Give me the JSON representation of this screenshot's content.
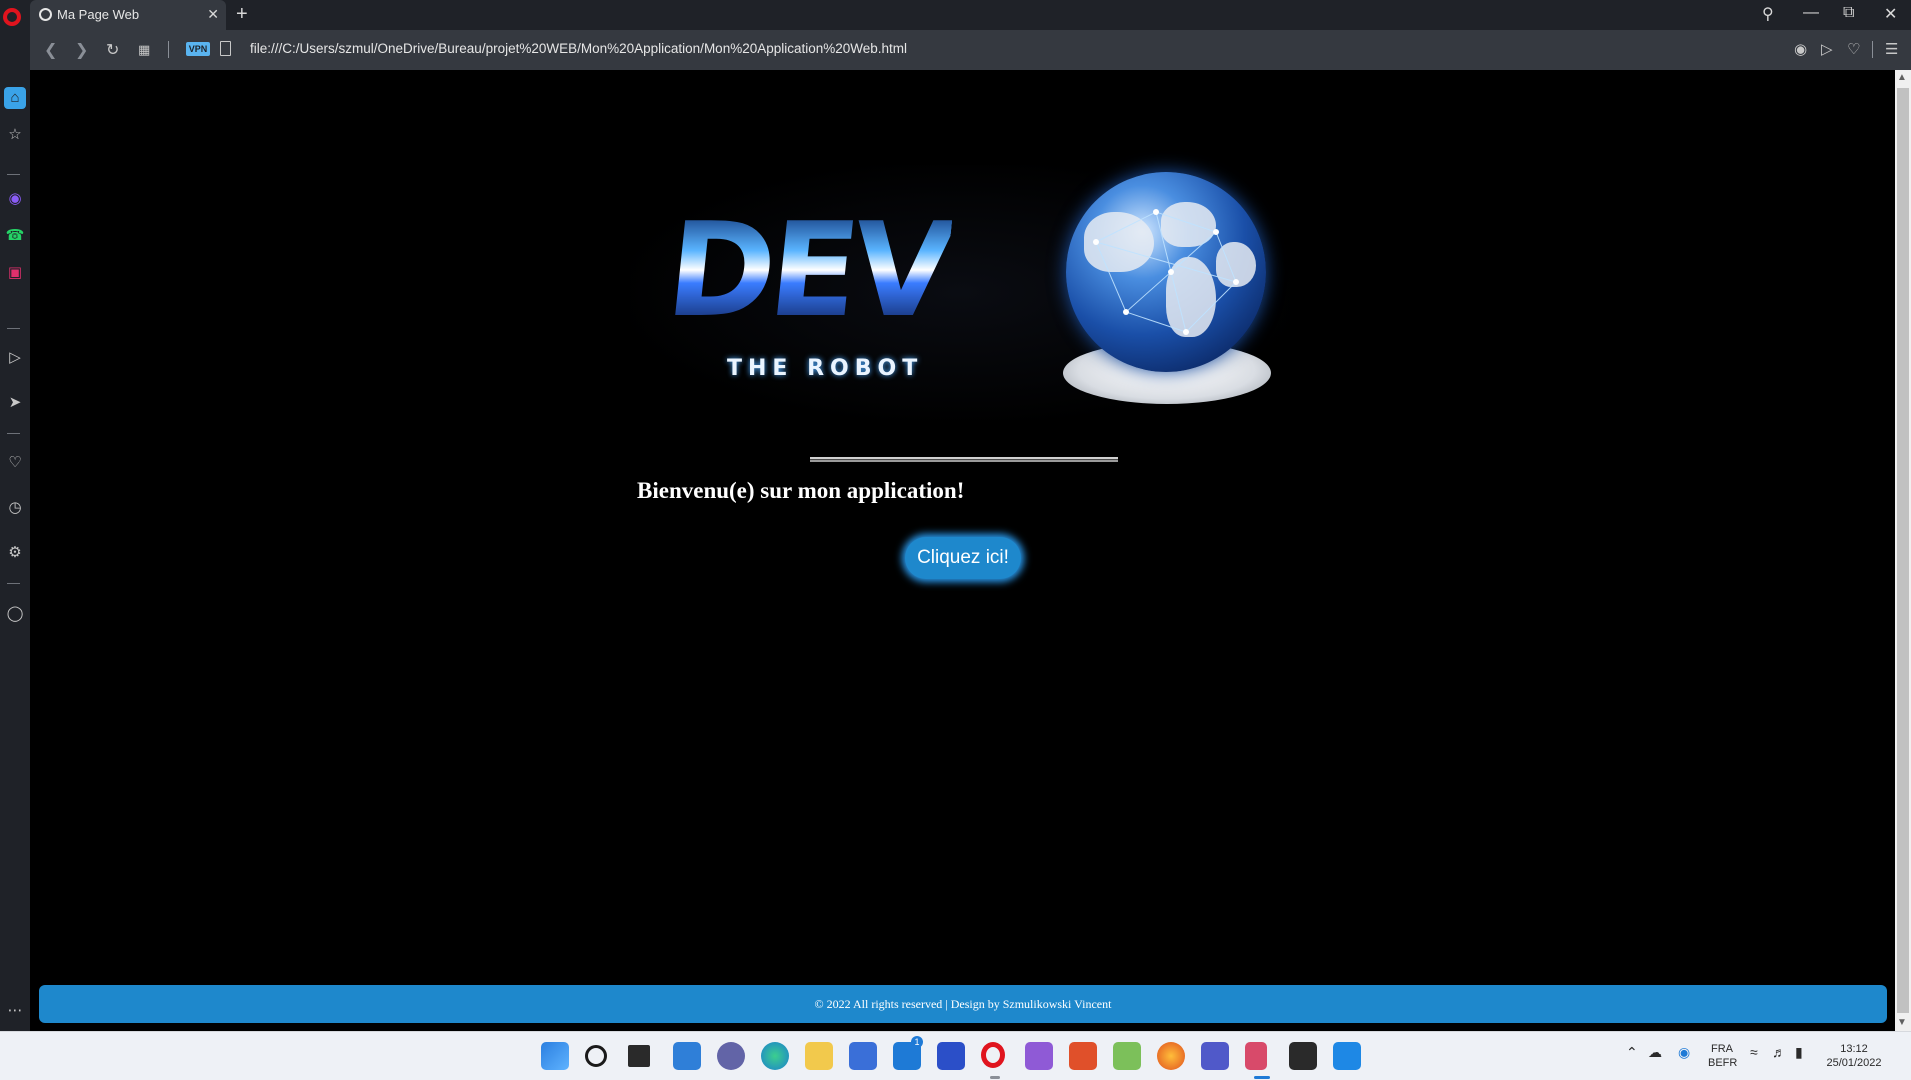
{
  "browser": {
    "tab_title": "Ma Page Web",
    "tab_close": "✕",
    "new_tab": "+",
    "url": "file:///C:/Users/szmul/OneDrive/Bureau/projet%20WEB/Mon%20Application/Mon%20Application%20Web.html",
    "vpn_badge": "VPN"
  },
  "page": {
    "logo_main": "DEV",
    "logo_sub": "THE ROBOT",
    "welcome": "Bienvenu(e) sur mon application!",
    "button_label": "Cliquez ici!",
    "footer": "© 2022 All rights reserved | Design by Szmulikowski Vincent"
  },
  "taskbar": {
    "language_top": "FRA",
    "language_bottom": "BEFR",
    "time": "13:12",
    "date": "25/01/2022",
    "mail_badge": "1"
  },
  "colors": {
    "accent": "#1e88cc",
    "browser_dark": "#1f2228",
    "browser_bar": "#353940",
    "page_bg": "#000000"
  }
}
